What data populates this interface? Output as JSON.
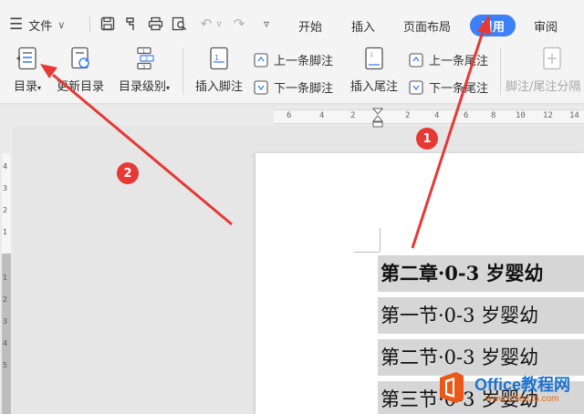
{
  "menu": {
    "file_label": "文件",
    "tabs": [
      {
        "label": "开始"
      },
      {
        "label": "插入"
      },
      {
        "label": "页面布局"
      },
      {
        "label": "引用",
        "active": true
      },
      {
        "label": "审阅"
      }
    ]
  },
  "ribbon": {
    "toc": "目录",
    "update_toc": "更新目录",
    "toc_level": "目录级别",
    "insert_footnote": "插入脚注",
    "prev_footnote": "上一条脚注",
    "next_footnote": "下一条脚注",
    "insert_endnote": "插入尾注",
    "prev_endnote": "上一条尾注",
    "next_endnote": "下一条尾注",
    "footnote_endnote_sep": "脚注/尾注分隔"
  },
  "ruler": {
    "ticks": [
      "6",
      "4",
      "2",
      "2",
      "4",
      "6",
      "8",
      "10",
      "12",
      "14"
    ],
    "vertical_ticks": [
      "4",
      "3",
      "2",
      "1",
      "1",
      "2",
      "3",
      "4",
      "5"
    ]
  },
  "document": {
    "lines": [
      {
        "text": "第二章·0-3 岁婴幼",
        "bold": true
      },
      {
        "text": "第一节·0-3 岁婴幼",
        "bold": false
      },
      {
        "text": "第二节·0-3 岁婴幼",
        "bold": false
      },
      {
        "text": "第三节·0-3 岁婴幼",
        "bold": false
      }
    ]
  },
  "annotations": {
    "badge1": "1",
    "badge2": "2",
    "arrow_color": "#e53935"
  },
  "watermark": {
    "title": "Office教程网",
    "url": "www.office26.com"
  },
  "colors": {
    "accent": "#3d7ff7",
    "selection": "#d6d6d6"
  }
}
